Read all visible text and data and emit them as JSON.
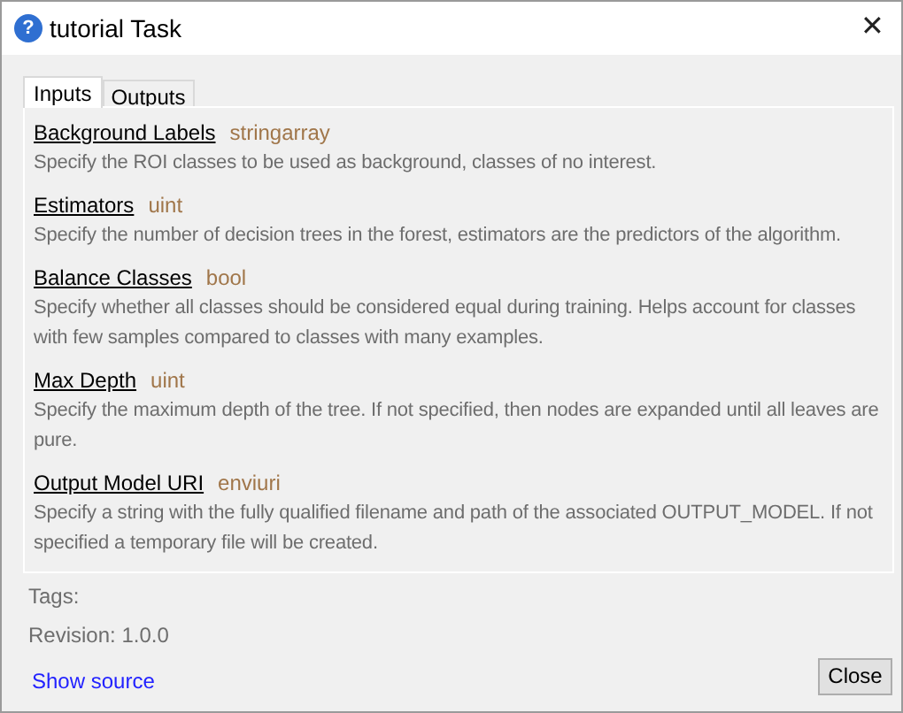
{
  "window": {
    "icon": "?",
    "title": "tutorial Task",
    "close": "✕"
  },
  "tabs": [
    {
      "label": "Inputs",
      "selected": true
    },
    {
      "label": "Outputs",
      "selected": false
    }
  ],
  "parameters": [
    {
      "name": "Background Labels",
      "type": "stringarray",
      "description": "Specify the ROI classes to be used as background, classes of no interest."
    },
    {
      "name": "Estimators",
      "type": "uint",
      "description": "Specify the number of decision trees in the forest, estimators are the predictors of the algorithm."
    },
    {
      "name": "Balance Classes",
      "type": "bool",
      "description": "Specify whether all classes should be considered equal during training. Helps account for classes with few samples compared to classes with many examples."
    },
    {
      "name": "Max Depth",
      "type": "uint",
      "description": "Specify the maximum depth of the tree. If not specified, then nodes are expanded until all leaves are pure."
    },
    {
      "name": "Output Model URI",
      "type": "enviuri",
      "description": "Specify a string with the fully qualified filename and path of the associated OUTPUT_MODEL. If not specified a temporary file will be created."
    }
  ],
  "tags": "Tags:",
  "revision": "Revision: 1.0.0",
  "show_source": "Show source",
  "close_button": "Close"
}
